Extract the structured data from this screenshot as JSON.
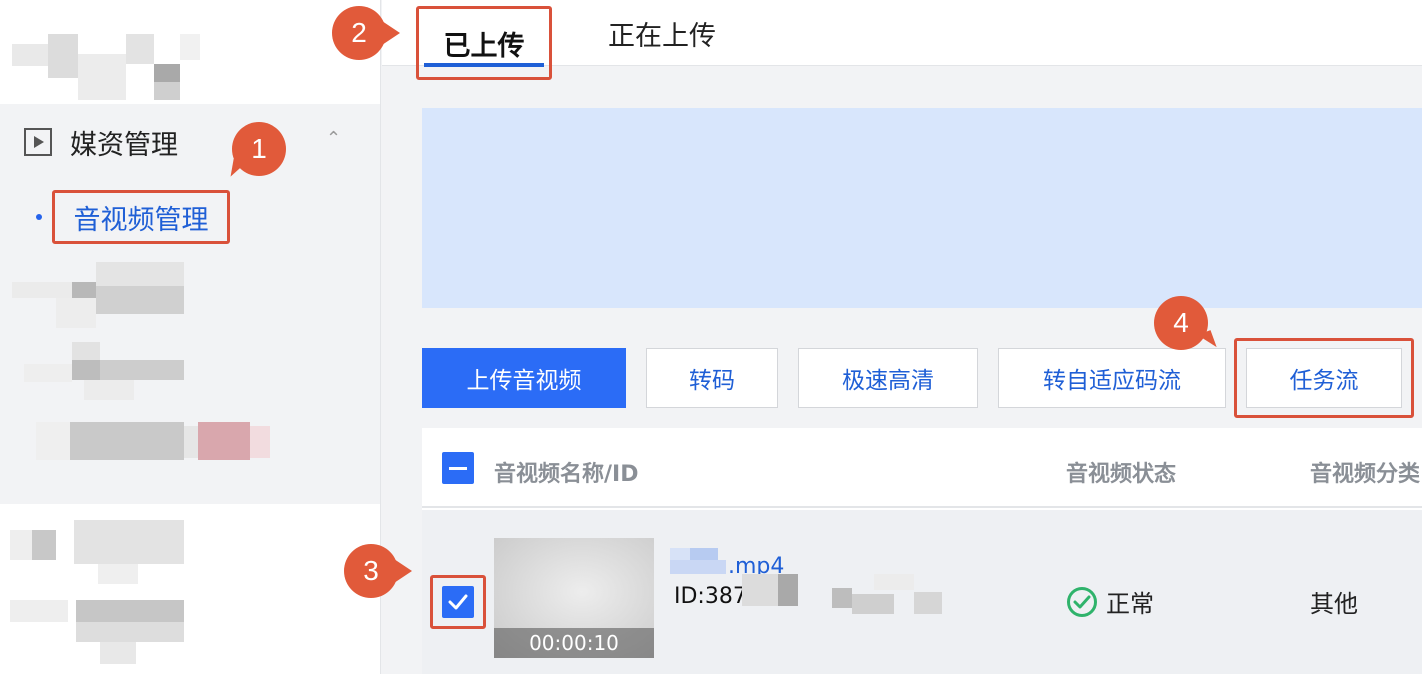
{
  "sidebar": {
    "menu_title": "媒资管理",
    "active_item": "音视频管理",
    "collapse_glyph": "⌃"
  },
  "tabs": {
    "uploaded": "已上传",
    "uploading": "正在上传"
  },
  "toolbar": {
    "upload": "上传音视频",
    "transcode": "转码",
    "fast_hd": "极速高清",
    "adaptive": "转自适应码流",
    "taskflow": "任务流"
  },
  "table": {
    "headers": {
      "name": "音视频名称/ID",
      "status": "音视频状态",
      "category": "音视频分类"
    },
    "rows": [
      {
        "duration": "00:00:10",
        "name_suffix": ".mp4",
        "id": "ID:387",
        "status": "正常",
        "category": "其他"
      }
    ]
  },
  "markers": [
    "1",
    "2",
    "3",
    "4"
  ],
  "colors": {
    "accent": "#2b6cf6",
    "annotation": "#e15a3a",
    "status_ok": "#2fb36b"
  }
}
